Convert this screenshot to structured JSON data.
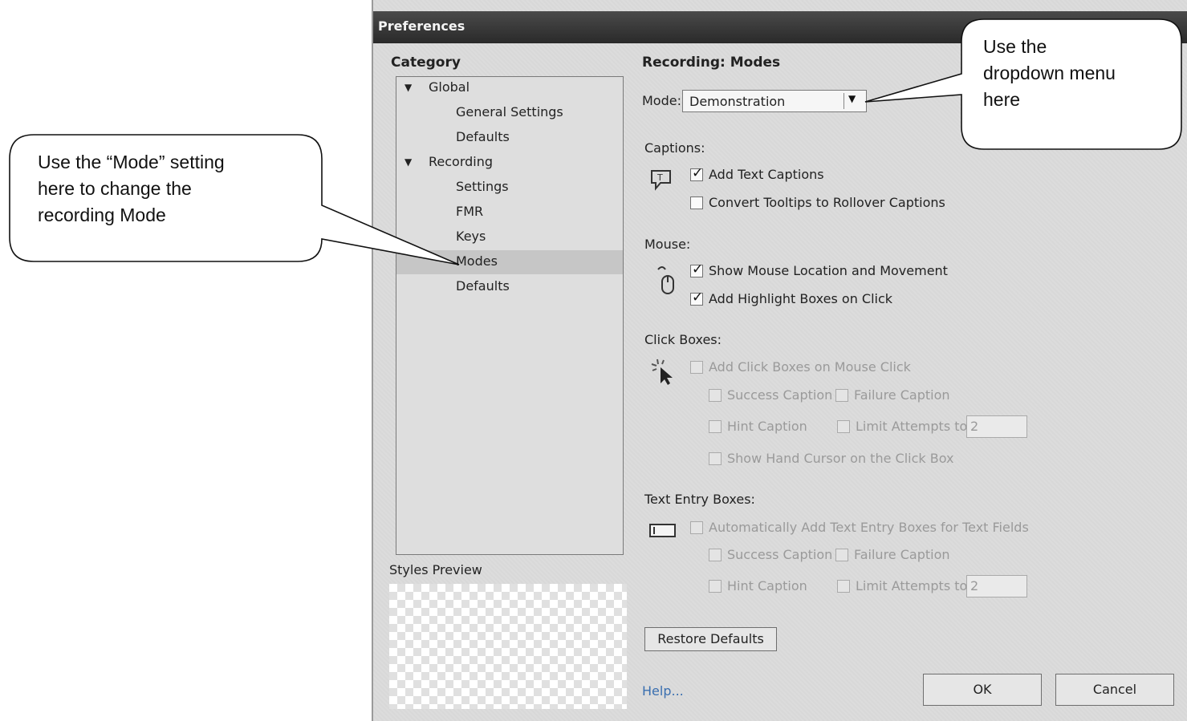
{
  "window": {
    "title": "Preferences"
  },
  "category": {
    "heading": "Category",
    "items": [
      {
        "label": "Global",
        "expanded": true
      },
      {
        "label": "General Settings"
      },
      {
        "label": "Defaults"
      },
      {
        "label": "Recording",
        "expanded": true
      },
      {
        "label": "Settings"
      },
      {
        "label": "FMR"
      },
      {
        "label": "Keys"
      },
      {
        "label": "Modes",
        "selected": true
      },
      {
        "label": "Defaults"
      }
    ]
  },
  "styles_preview": {
    "label": "Styles Preview"
  },
  "panel": {
    "heading": "Recording: Modes",
    "mode": {
      "label": "Mode:",
      "value": "Demonstration"
    },
    "captions": {
      "label": "Captions:",
      "add_text_captions": {
        "label": "Add Text Captions",
        "checked": true
      },
      "convert_tooltips": {
        "label": "Convert Tooltips to Rollover Captions",
        "checked": false
      }
    },
    "mouse": {
      "label": "Mouse:",
      "show_mouse": {
        "label": "Show Mouse Location and Movement",
        "checked": true
      },
      "add_highlight": {
        "label": "Add Highlight Boxes on Click",
        "checked": true
      }
    },
    "click_boxes": {
      "label": "Click Boxes:",
      "add_click_boxes": {
        "label": "Add Click Boxes on Mouse Click",
        "checked": false
      },
      "success_caption": "Success Caption",
      "failure_caption": "Failure Caption",
      "hint_caption": "Hint Caption",
      "limit_attempts": "Limit Attempts to",
      "limit_value": "2",
      "show_hand_cursor": "Show Hand Cursor on the Click Box"
    },
    "text_entry_boxes": {
      "label": "Text Entry Boxes:",
      "auto_add": {
        "label": "Automatically Add Text Entry Boxes for Text Fields",
        "checked": false
      },
      "success_caption": "Success Caption",
      "failure_caption": "Failure Caption",
      "hint_caption": "Hint Caption",
      "limit_attempts": "Limit Attempts to",
      "limit_value": "2"
    },
    "restore_defaults": "Restore Defaults"
  },
  "footer": {
    "help": "Help...",
    "ok": "OK",
    "cancel": "Cancel"
  },
  "callouts": {
    "left": [
      "Use the “Mode” setting",
      "here to change the",
      "recording Mode"
    ],
    "right": [
      "Use the",
      "dropdown menu",
      "here"
    ]
  }
}
